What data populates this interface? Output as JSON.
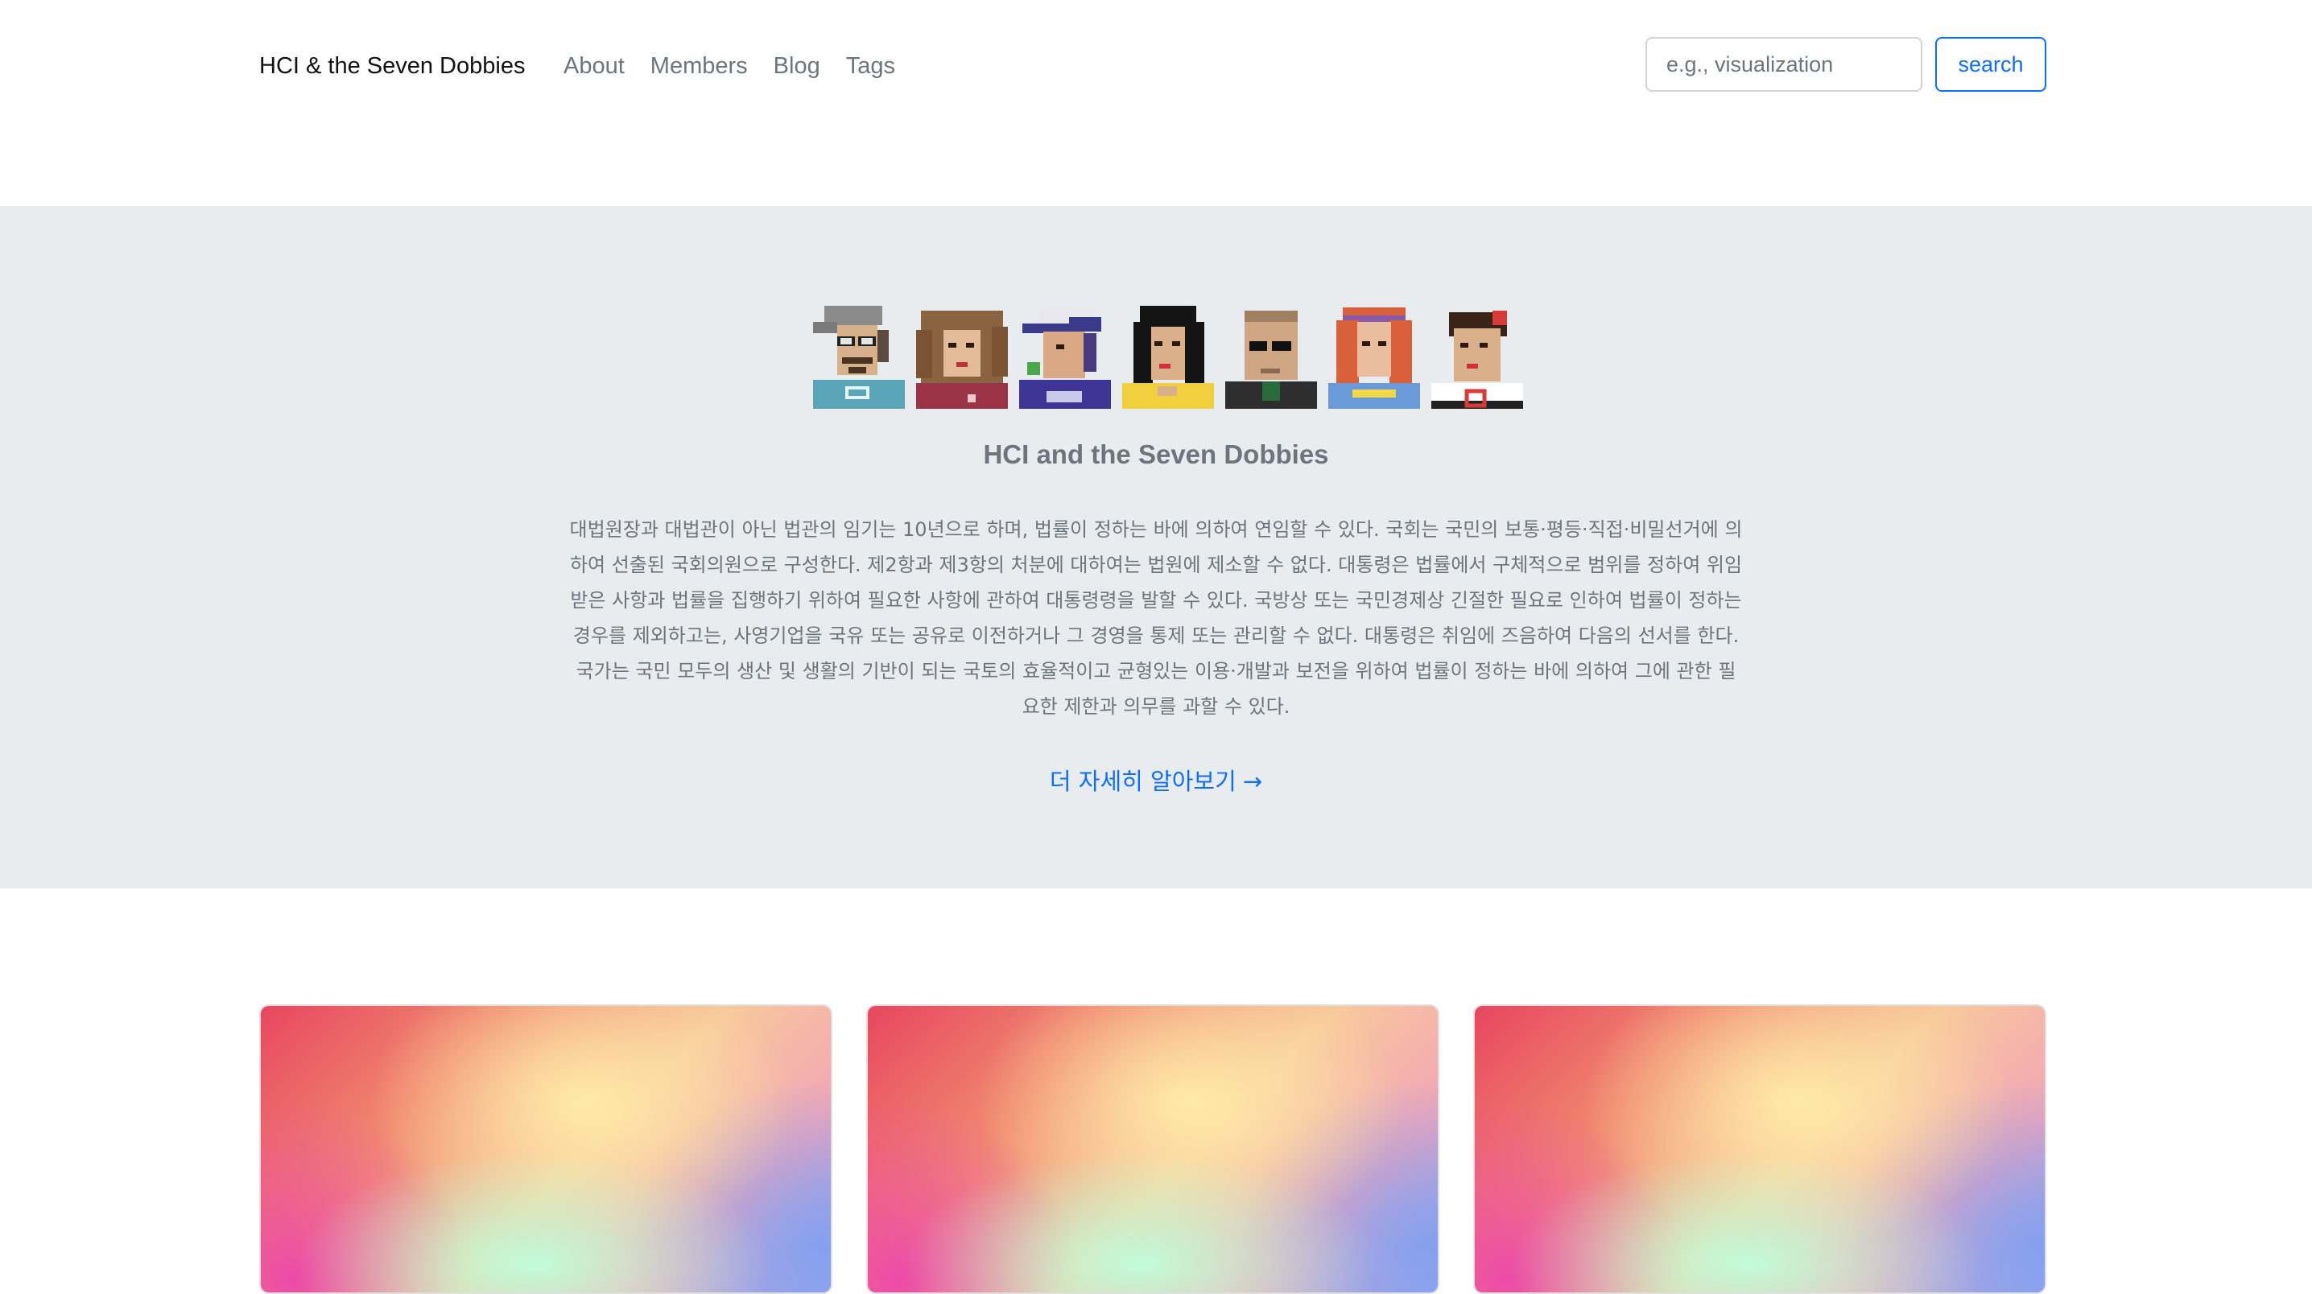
{
  "navbar": {
    "brand": "HCI & the Seven Dobbies",
    "links": [
      "About",
      "Members",
      "Blog",
      "Tags"
    ],
    "search": {
      "placeholder": "e.g., visualization",
      "value": "",
      "button": "search"
    }
  },
  "hero": {
    "title": "HCI and the Seven Dobbies",
    "description": "대법원장과 대법관이 아닌 법관의 임기는 10년으로 하며, 법률이 정하는 바에 의하여 연임할 수 있다. 국회는 국민의 보통·평등·직접·비밀선거에 의하여 선출된 국회의원으로 구성한다. 제2항과 제3항의 처분에 대하여는 법원에 제소할 수 없다. 대통령은 법률에서 구체적으로 범위를 정하여 위임받은 사항과 법률을 집행하기 위하여 필요한 사항에 관하여 대통령령을 발할 수 있다. 국방상 또는 국민경제상 긴절한 필요로 인하여 법률이 정하는 경우를 제외하고는, 사영기업을 국유 또는 공유로 이전하거나 그 경영을 통제 또는 관리할 수 없다. 대통령은 취임에 즈음하여 다음의 선서를 한다. 국가는 국민 모두의 생산 및 생활의 기반이 되는 국토의 효율적이고 균형있는 이용·개발과 보전을 위하여 법률이 정하는 바에 의하여 그에 관한 필요한 제한과 의무를 과할 수 있다.",
    "link": "더 자세히 알아보기",
    "link_arrow": "→",
    "avatar_icons": [
      "avatar-cap-glasses-icon",
      "avatar-curly-hair-icon",
      "avatar-ny-cap-icon",
      "avatar-long-black-hair-icon",
      "avatar-sunglasses-icon",
      "avatar-red-hair-icon",
      "avatar-short-hair-icon"
    ]
  },
  "cards": [
    {
      "image": "gradient-image"
    },
    {
      "image": "gradient-image"
    },
    {
      "image": "gradient-image"
    }
  ],
  "colors": {
    "accent": "#0d6efd",
    "hero_bg": "#e9ecef",
    "muted": "#6c757d"
  }
}
